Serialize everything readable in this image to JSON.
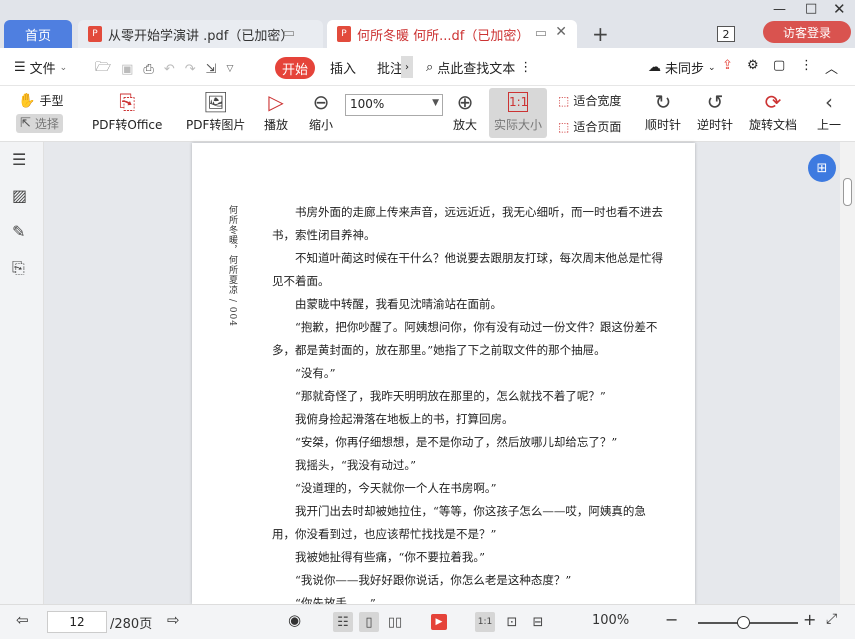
{
  "tabs": {
    "home": "首页",
    "doc1": "从零开始学演讲 .pdf（已加密）",
    "doc2": "何所冬暖 何所...df（已加密）",
    "count": "2",
    "login": "访客登录"
  },
  "menu": {
    "file": "文件",
    "start": "开始",
    "insert": "插入",
    "annotate": "批注",
    "search": "点此查找文本",
    "sync": "未同步"
  },
  "toolbar": {
    "hand": "手型",
    "select": "选择",
    "pdf_office": "PDF转Office",
    "pdf_image": "PDF转图片",
    "play": "播放",
    "zoom_out": "缩小",
    "zoom_value": "100%",
    "zoom_in": "放大",
    "actual_size": "实际大小",
    "fit_width": "适合宽度",
    "fit_page": "适合页面",
    "clockwise": "顺时针",
    "counter_clockwise": "逆时针",
    "rotate_doc": "旋转文档",
    "prev": "上一"
  },
  "page": {
    "running_head": "何所冬暖，何所夏凉 / 004",
    "paragraphs": [
      "书房外面的走廊上传来声音，远远近近，我无心细听，而一时也看不进去",
      "书，索性闭目养神。",
      "不知道叶蔺这时候在干什么？他说要去跟朋友打球，每次周末他总是忙得",
      "见不着面。",
      "由蒙眬中转醒，我看见沈晴渝站在面前。",
      "“抱歉，把你吵醒了。阿姨想问你，你有没有动过一份文件？跟这份差不",
      "多，都是黄封面的，放在那里。”她指了下之前取文件的那个抽屉。",
      "“没有。”",
      "“那就奇怪了，我昨天明明放在那里的，怎么就找不着了呢？”",
      "我俯身捡起滑落在地板上的书，打算回房。",
      "“安桀，你再仔细想想，是不是你动了，然后放哪儿却给忘了？”",
      "我摇头，“我没有动过。”",
      "“没道理的，今天就你一个人在书房啊。”",
      "我开门出去时却被她拉住，“等等，你这孩子怎么——哎，阿姨真的急",
      "用，你没看到过，也应该帮忙找找是不是？”",
      "我被她扯得有些痛，“你不要拉着我。”",
      "“我说你——我好好跟你说话，你怎么老是这种态度？”",
      "“你先放手……”"
    ]
  },
  "status": {
    "current_page": "12",
    "total_pages": "/280页",
    "zoom": "100%",
    "zoom_fraction": 0.45
  }
}
